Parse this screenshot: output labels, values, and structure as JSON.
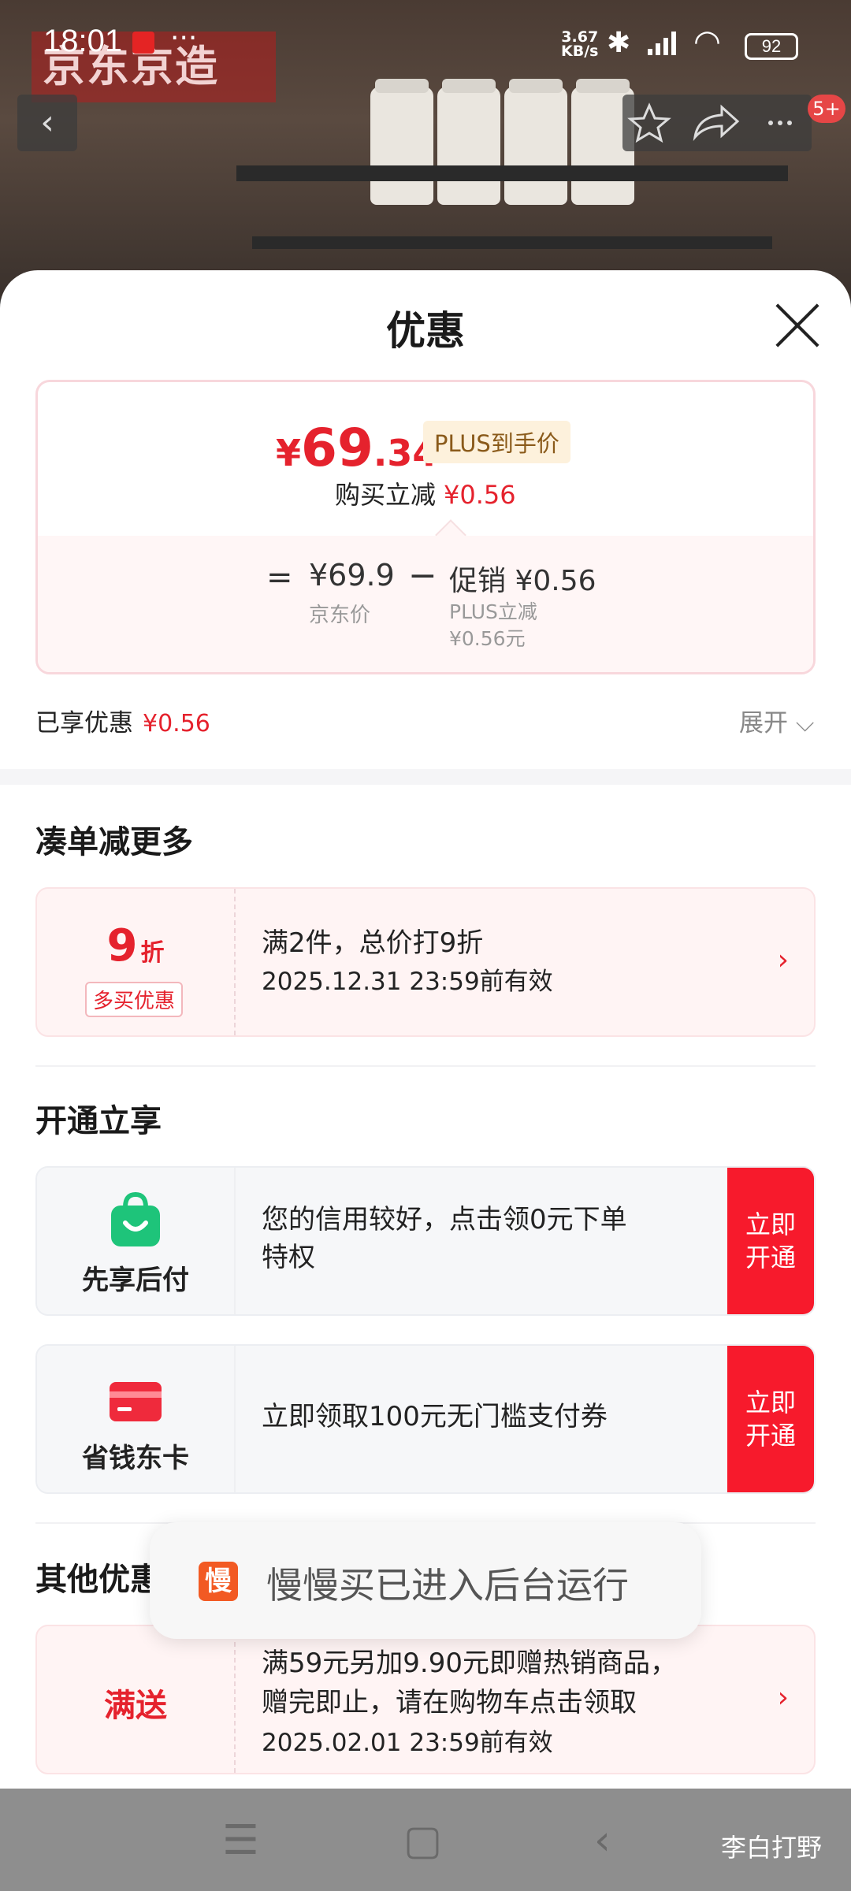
{
  "status_bar": {
    "time": "18:01",
    "dots": "···",
    "net_speed": "3.67",
    "net_unit": "KB/s",
    "battery": "92"
  },
  "header": {
    "brand": "京东京造",
    "cart_badge": "5+"
  },
  "sheet": {
    "title": "优惠",
    "price": {
      "yen": "¥",
      "integer": "69",
      "decimal": ".34",
      "plus_tag": "PLUS到手价",
      "buy_reduce_label": "购买立减",
      "buy_reduce_value": "¥0.56",
      "equals": "=",
      "jd_price": "¥69.9",
      "jd_price_label": "京东价",
      "minus": "−",
      "promo": "促销 ¥0.56",
      "promo_sub1": "PLUS立减",
      "promo_sub2": "¥0.56元"
    },
    "enjoyed_label": "已享优惠",
    "enjoyed_value": "¥0.56",
    "expand_label": "展开 ⌵"
  },
  "sections": {
    "bundle": {
      "title": "凑单减更多",
      "card": {
        "discount_num": "9",
        "discount_unit": "折",
        "tag": "多买优惠",
        "line1": "满2件，总价打9折",
        "line2": "2025.12.31 23:59前有效",
        "arrow": "›"
      }
    },
    "activate": {
      "title": "开通立享",
      "cards": [
        {
          "name": "先享后付",
          "desc1": "您的信用较好，点击领0元下单",
          "desc2": "特权",
          "cta1": "立即",
          "cta2": "开通"
        },
        {
          "name": "省钱东卡",
          "desc1": "立即领取100元无门槛支付券",
          "desc2": "",
          "cta1": "立即",
          "cta2": "开通"
        }
      ]
    },
    "other": {
      "title": "其他优惠",
      "card": {
        "label": "满送",
        "line1": "满59元另加9.90元即赠热销商品，",
        "line2": "赠完即止，请在购物车点击领取",
        "line3": "2025.02.01 23:59前有效",
        "arrow": "›"
      }
    }
  },
  "toast": {
    "icon_char": "慢",
    "text": "慢慢买已进入后台运行"
  },
  "navbar": {
    "menu": "☰",
    "home": "▢",
    "back": "‹",
    "signature": "李白打野"
  }
}
